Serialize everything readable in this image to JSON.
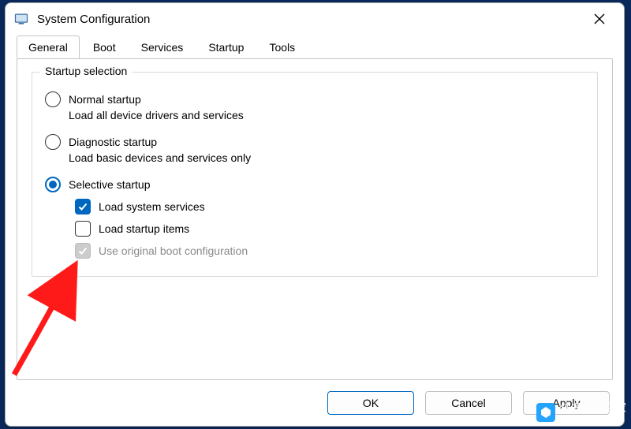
{
  "window": {
    "title": "System Configuration"
  },
  "tabs": [
    {
      "label": "General",
      "active": true
    },
    {
      "label": "Boot",
      "active": false
    },
    {
      "label": "Services",
      "active": false
    },
    {
      "label": "Startup",
      "active": false
    },
    {
      "label": "Tools",
      "active": false
    }
  ],
  "group": {
    "title": "Startup selection",
    "radios": {
      "normal": {
        "label": "Normal startup",
        "desc": "Load all device drivers and services",
        "checked": false
      },
      "diagnostic": {
        "label": "Diagnostic startup",
        "desc": "Load basic devices and services only",
        "checked": false
      },
      "selective": {
        "label": "Selective startup",
        "checked": true
      }
    },
    "checks": {
      "sys_services": {
        "label": "Load system services",
        "checked": true,
        "disabled": false
      },
      "startup_items": {
        "label": "Load startup items",
        "checked": false,
        "disabled": false
      },
      "orig_boot": {
        "label": "Use original boot configuration",
        "checked": true,
        "disabled": true
      }
    }
  },
  "buttons": {
    "ok": "OK",
    "cancel": "Cancel",
    "apply": "Apply"
  },
  "watermark": {
    "text": "纯净系统之家",
    "url": "www.ycwjzy.com"
  }
}
